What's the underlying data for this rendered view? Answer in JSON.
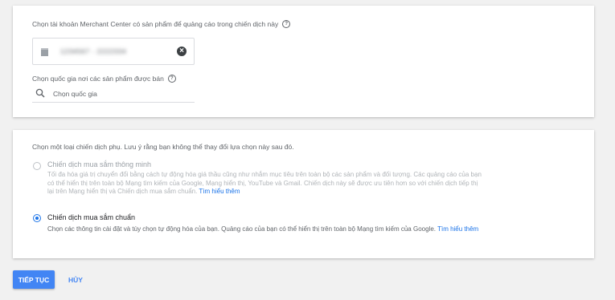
{
  "merchant_section": {
    "account_label": "Chọn tài khoản Merchant Center có sản phẩm để quảng cáo trong chiến dịch này",
    "account_id": "1234567 - 2222334",
    "country_label": "Chọn quốc gia nơi các sản phẩm được bán",
    "country_placeholder": "Chọn quốc gia",
    "help_glyph": "?"
  },
  "subtype_section": {
    "instruction": "Chọn một loại chiến dịch phụ. Lưu ý rằng bạn không thể thay đổi lựa chọn này sau đó.",
    "options": [
      {
        "title": "Chiến dịch mua sắm thông minh",
        "description": "Tối đa hóa giá trị chuyển đổi bằng cách tự động hóa giá thầu cũng như nhắm mục tiêu trên toàn bộ các sản phẩm và đối tượng. Các quảng cáo của bạn có thể hiển thị trên toàn bộ Mạng tìm kiếm của Google, Mạng hiển thị, YouTube và Gmail. Chiến dịch này sẽ được ưu tiên hơn so với chiến dịch tiếp thị lại trên Mạng hiển thị và Chiến dịch mua sắm chuẩn.",
        "learn_more": "Tìm hiểu thêm",
        "selected": false,
        "disabled": true
      },
      {
        "title": "Chiến dịch mua sắm chuẩn",
        "description": "Chọn các thông tin cài đặt và tùy chọn tự động hóa của bạn. Quảng cáo của bạn có thể hiển thị trên toàn bộ Mạng tìm kiếm của Google.",
        "learn_more": "Tìm hiểu thêm",
        "selected": true,
        "disabled": false
      }
    ]
  },
  "actions": {
    "continue_label": "TIẾP TỤC",
    "cancel_label": "HỦY"
  },
  "colors": {
    "accent": "#4285f4",
    "link": "#1a73e8",
    "background": "#f1f1f1"
  }
}
